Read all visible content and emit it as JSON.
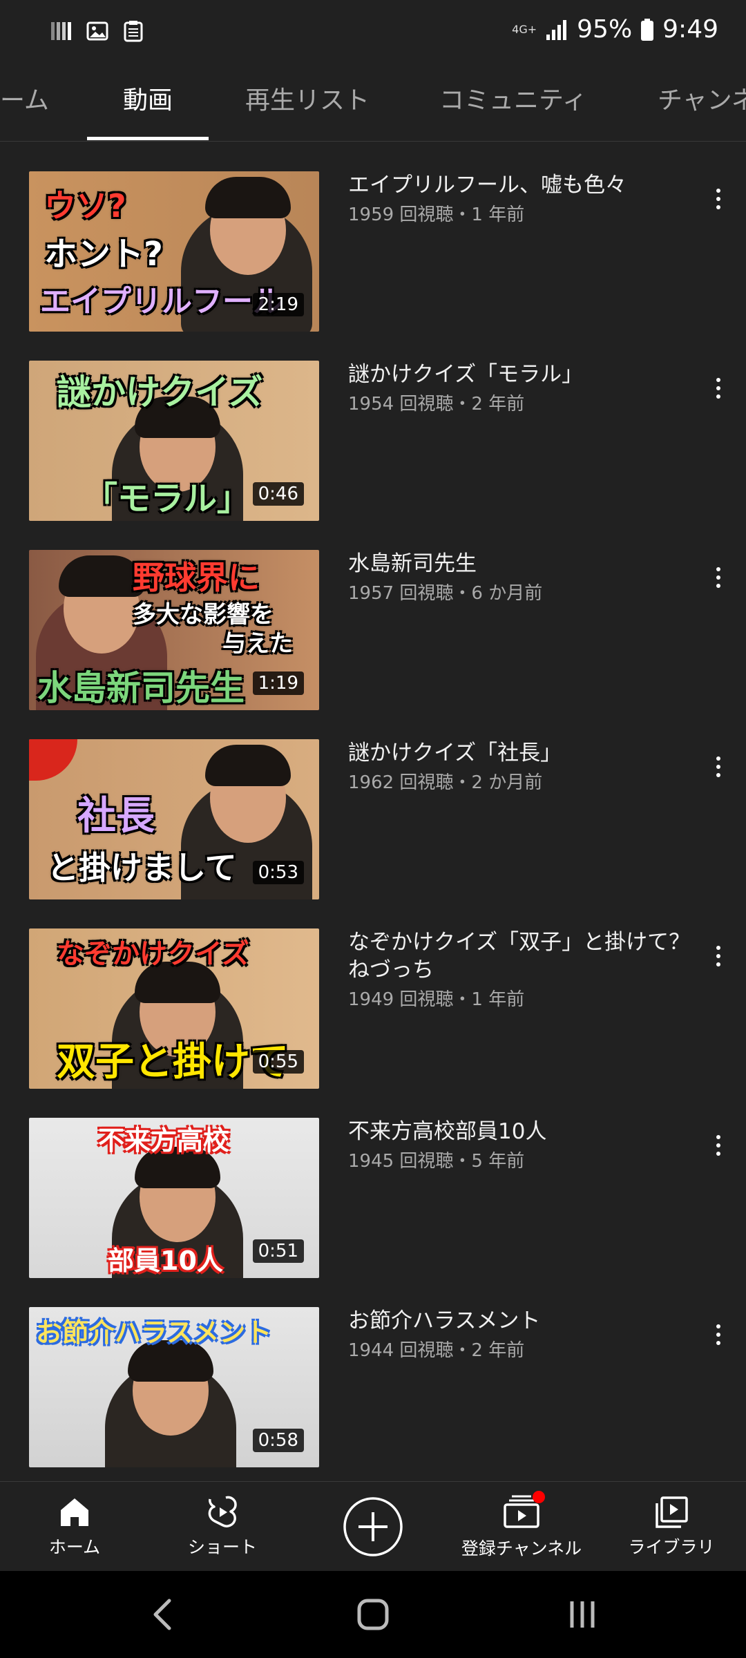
{
  "status_bar": {
    "network": "4G+",
    "battery": "95%",
    "time": "9:49"
  },
  "tabs": [
    {
      "label": "ーム"
    },
    {
      "label": "動画"
    },
    {
      "label": "再生リスト"
    },
    {
      "label": "コミュニティ"
    },
    {
      "label": "チャンネ"
    }
  ],
  "videos": [
    {
      "title": "エイプリルフール、嘘も色々",
      "meta": "1959 回視聴・1 年前",
      "duration": "2:19",
      "thumb_lines": [
        "ウソ?",
        "ホント?",
        "エイプリルフール"
      ],
      "thumb_colors": [
        "#ff3b30",
        "#ffffff",
        "#e0b0ff"
      ]
    },
    {
      "title": "謎かけクイズ「モラル」",
      "meta": "1954 回視聴・2 年前",
      "duration": "0:46",
      "thumb_lines": [
        "謎かけクイズ",
        "「モラル」"
      ],
      "thumb_colors": [
        "#a8f0a0",
        "#a8f0a0"
      ]
    },
    {
      "title": "水島新司先生",
      "meta": "1957 回視聴・6 か月前",
      "duration": "1:19",
      "thumb_lines": [
        "野球界に",
        "多大な影響を",
        "与えた",
        "水島新司先生"
      ],
      "thumb_colors": [
        "#ff3b30",
        "#ffffff",
        "#ffffff",
        "#7cd67c"
      ]
    },
    {
      "title": "謎かけクイズ「社長」",
      "meta": "1962 回視聴・2 か月前",
      "duration": "0:53",
      "thumb_lines": [
        "社長",
        "と掛けまして"
      ],
      "thumb_colors": [
        "#d7a8ff",
        "#ffffff"
      ]
    },
    {
      "title": "なぞかけクイズ「双子」と掛けて？ねづっち",
      "meta": "1949 回視聴・1 年前",
      "duration": "0:55",
      "thumb_lines": [
        "なぞかけクイズ",
        "双子と掛けて"
      ],
      "thumb_colors": [
        "#ff3b30",
        "#ffe600"
      ]
    },
    {
      "title": "不来方高校部員10人",
      "meta": "1945 回視聴・5 年前",
      "duration": "0:51",
      "thumb_lines": [
        "不来方高校",
        "部員10人"
      ],
      "thumb_colors": [
        "#ffffff",
        "#ffffff"
      ]
    },
    {
      "title": "お節介ハラスメント",
      "meta": "1944 回視聴・2 年前",
      "duration": "0:58",
      "thumb_lines": [
        "お節介ハラスメント"
      ],
      "thumb_colors": [
        "#ffe45c"
      ]
    }
  ],
  "bottom_nav": [
    {
      "label": "ホーム",
      "icon": "home-icon"
    },
    {
      "label": "ショート",
      "icon": "shorts-icon"
    },
    {
      "label": "",
      "icon": "create-icon"
    },
    {
      "label": "登録チャンネル",
      "icon": "subscriptions-icon"
    },
    {
      "label": "ライブラリ",
      "icon": "library-icon"
    }
  ],
  "colors": {
    "background": "#212121",
    "text_primary": "#f1f1f1",
    "text_secondary": "#aaaaaa",
    "badge": "#ff0000"
  }
}
